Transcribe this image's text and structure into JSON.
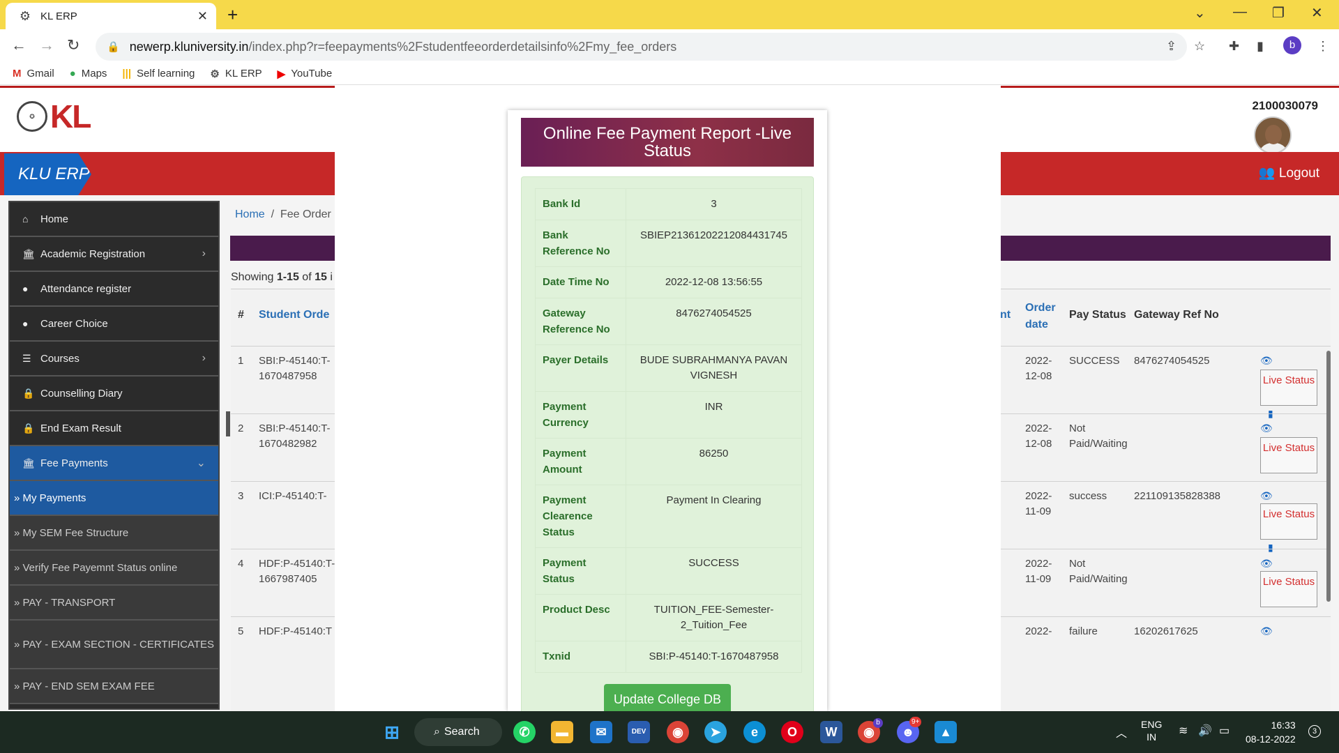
{
  "browser": {
    "tab_title": "KL ERP",
    "url_domain": "newerp.kluniversity.in",
    "url_path": "/index.php?r=feepayments%2Fstudentfeeorderdetailsinfo%2Fmy_fee_orders",
    "profile_initial": "b",
    "bookmarks": [
      "Gmail",
      "Maps",
      "Self learning",
      "KL ERP",
      "YouTube"
    ]
  },
  "header": {
    "logo_text": "KL",
    "user_id": "2100030079",
    "brand": "KLU ERP",
    "logout_label": "Logout"
  },
  "sidebar": {
    "items": [
      {
        "label": "Home",
        "icon": "home-icon"
      },
      {
        "label": "Academic Registration",
        "icon": "bank-icon"
      },
      {
        "label": "Attendance register",
        "icon": "clock-icon"
      },
      {
        "label": "Career Choice",
        "icon": "clock-icon"
      },
      {
        "label": "Courses",
        "icon": "list-icon"
      },
      {
        "label": "Counselling Diary",
        "icon": "lock-icon"
      },
      {
        "label": "End Exam Result",
        "icon": "lock-icon"
      },
      {
        "label": "Fee Payments",
        "icon": "bank-icon"
      }
    ],
    "subitems": [
      "» My Payments",
      "» My SEM Fee Structure",
      "» Verify Fee Payemnt Status online",
      "» PAY - TRANSPORT",
      "» PAY - EXAM SECTION - CERTIFICATES",
      "» PAY - END SEM EXAM FEE"
    ]
  },
  "content": {
    "breadcrumb_home": "Home",
    "breadcrumb_sep": "/",
    "breadcrumb_current": "Fee Order",
    "showing_prefix": "Showing ",
    "showing_range": "1-15",
    "showing_of": " of ",
    "showing_total": "15",
    "showing_trunc": " i",
    "columns": {
      "num": "#",
      "student_order": "Student Orde",
      "amount_trunc": "nt",
      "order_date": "Order date",
      "pay_status": "Pay Status",
      "gateway_ref": "Gateway Ref No"
    },
    "rows": [
      {
        "num": "1",
        "order": "SBI:P-45140:T-1670487958",
        "date": "2022-12-08",
        "status": "SUCCESS",
        "gateway": "8476274054525"
      },
      {
        "num": "2",
        "order": "SBI:P-45140:T-1670482982",
        "date": "2022-12-08",
        "status": "Not Paid/Waiting",
        "gateway": ""
      },
      {
        "num": "3",
        "order": "ICI:P-45140:T-",
        "date": "2022-11-09",
        "status": "success",
        "gateway": "221109135828388"
      },
      {
        "num": "4",
        "order": "HDF:P-45140:T-1667987405",
        "date": "2022-11-09",
        "status": "Not Paid/Waiting",
        "gateway": ""
      },
      {
        "num": "5",
        "order": "HDF:P-45140:T",
        "date": "2022-",
        "status": "failure",
        "gateway": "16202617625"
      }
    ],
    "live_status_label": "Live Status"
  },
  "modal": {
    "title": "Online Fee Payment Report -Live Status",
    "fields": [
      {
        "key": "Bank Id",
        "value": "3"
      },
      {
        "key": "Bank Reference No",
        "value": "SBIEP21361202212084431745"
      },
      {
        "key": "Date Time No",
        "value": "2022-12-08 13:56:55"
      },
      {
        "key": "Gateway Reference No",
        "value": "8476274054525"
      },
      {
        "key": "Payer Details",
        "value": "BUDE SUBRAHMANYA PAVAN VIGNESH"
      },
      {
        "key": "Payment Currency",
        "value": "INR"
      },
      {
        "key": "Payment Amount",
        "value": "86250"
      },
      {
        "key": "Payment Clearence Status",
        "value": "Payment In Clearing"
      },
      {
        "key": "Payment Status",
        "value": "SUCCESS"
      },
      {
        "key": "Product Desc",
        "value": "TUITION_FEE-Semester-2_Tuition_Fee"
      },
      {
        "key": "Txnid",
        "value": "SBI:P-45140:T-1670487958"
      }
    ],
    "update_button": "Update College DB"
  },
  "taskbar": {
    "search_label": "Search",
    "lang_line1": "ENG",
    "lang_line2": "IN",
    "time": "16:33",
    "date": "08-12-2022",
    "notification_count": "3",
    "discord_badge": "9+",
    "chrome_badge": "b"
  }
}
